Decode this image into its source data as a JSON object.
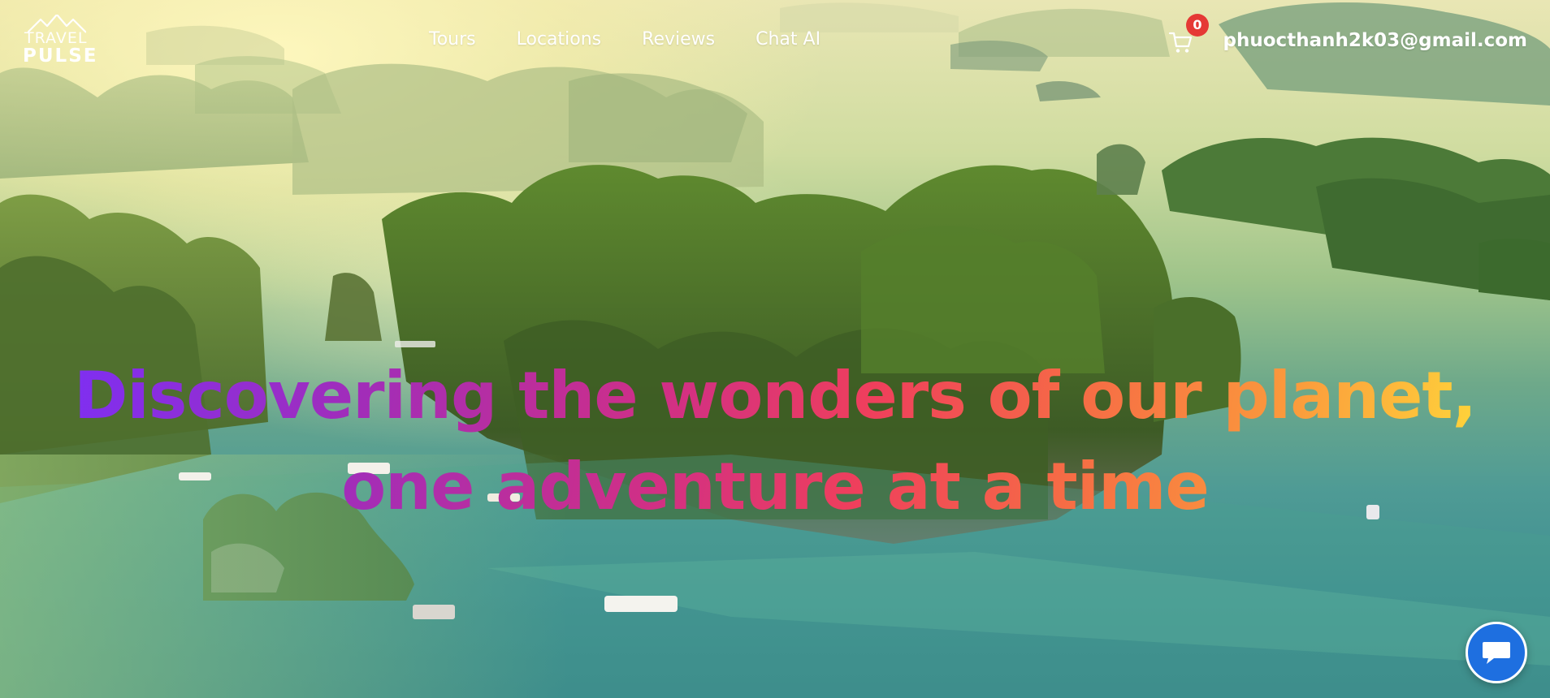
{
  "brand": {
    "line1": "TRAVEL",
    "line2": "PULSE"
  },
  "nav": {
    "items": [
      "Tours",
      "Locations",
      "Reviews",
      "Chat AI"
    ]
  },
  "cart": {
    "count": "0",
    "icon": "cart-icon"
  },
  "user": {
    "email": "phuocthanh2k03@gmail.com"
  },
  "hero": {
    "headline": "Discovering the wonders of our planet, one adventure at a time",
    "gradient_colors": [
      "#7b2ff7",
      "#d02f86",
      "#ef3f5c",
      "#fb9a3c",
      "#ffe23a"
    ]
  },
  "chat_widget": {
    "icon": "chat-bubble-icon",
    "color": "#1e6fe0"
  },
  "colors": {
    "badge": "#e53935",
    "nav_text": "#ffffff"
  }
}
